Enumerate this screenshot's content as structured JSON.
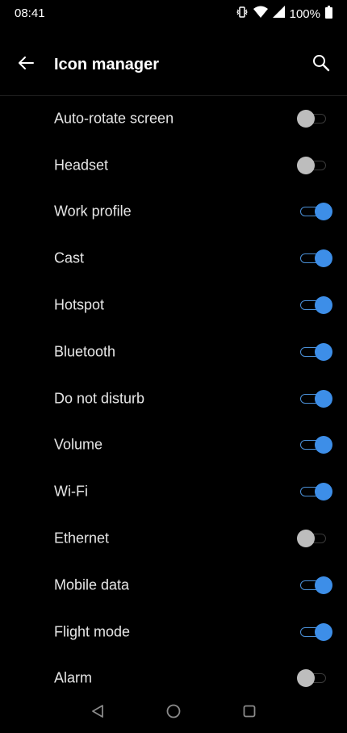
{
  "status_bar": {
    "time": "08:41",
    "battery": "100%",
    "icons": [
      "vibrate-icon",
      "wifi-icon",
      "signal-icon",
      "battery-icon"
    ]
  },
  "app_bar": {
    "title": "Icon manager",
    "back_icon": "back-arrow-icon",
    "search_icon": "search-icon"
  },
  "settings": [
    {
      "label": "Auto-rotate screen",
      "enabled": false
    },
    {
      "label": "Headset",
      "enabled": false
    },
    {
      "label": "Work profile",
      "enabled": true
    },
    {
      "label": "Cast",
      "enabled": true
    },
    {
      "label": "Hotspot",
      "enabled": true
    },
    {
      "label": "Bluetooth",
      "enabled": true
    },
    {
      "label": "Do not disturb",
      "enabled": true
    },
    {
      "label": "Volume",
      "enabled": true
    },
    {
      "label": "Wi-Fi",
      "enabled": true
    },
    {
      "label": "Ethernet",
      "enabled": false
    },
    {
      "label": "Mobile data",
      "enabled": true
    },
    {
      "label": "Flight mode",
      "enabled": true
    },
    {
      "label": "Alarm",
      "enabled": false
    }
  ],
  "nav_bar": {
    "icons": [
      "nav-back-icon",
      "nav-home-icon",
      "nav-recents-icon"
    ]
  },
  "colors": {
    "background": "#000000",
    "accent": "#3d8ee8",
    "thumb_off": "#bdbdbd",
    "text": "#e6e6e6"
  }
}
